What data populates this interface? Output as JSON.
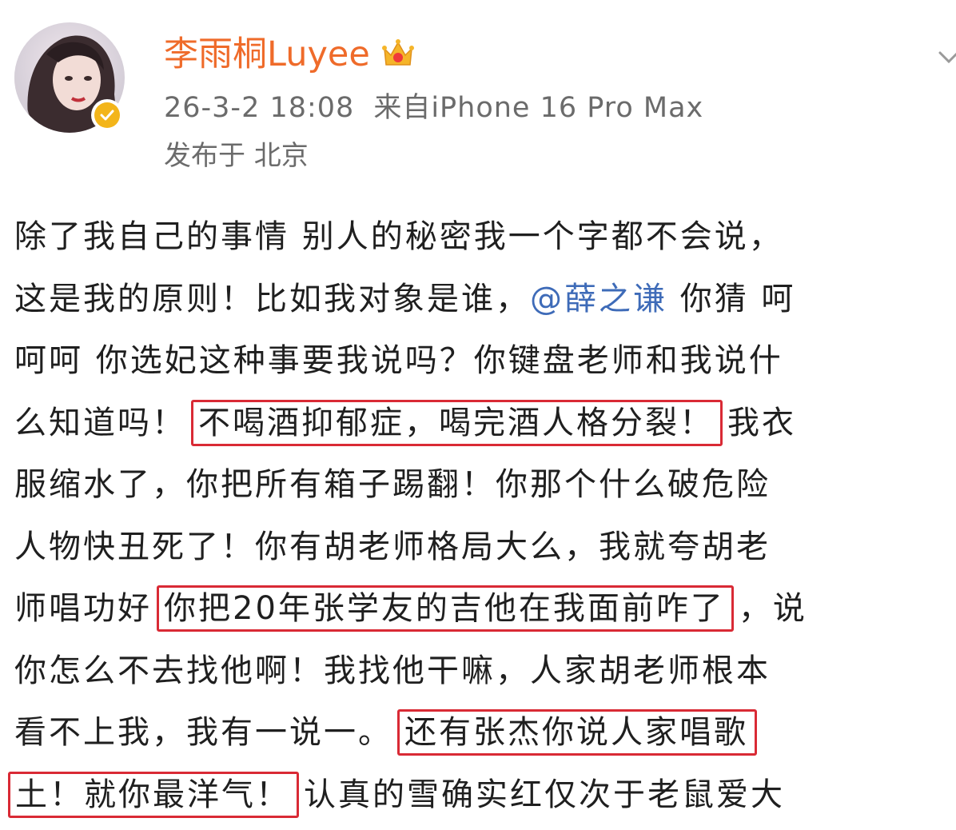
{
  "profile": {
    "username": "李雨桐Luyee",
    "timestamp": "26-3-2 18:08",
    "source": "来自iPhone 16 Pro Max",
    "location": "发布于 北京",
    "avatar_icon": "profile-photo",
    "verified_icon": "verified-badge-icon",
    "crown_icon": "vip-crown-icon",
    "menu_icon": "chevron-down-icon"
  },
  "colors": {
    "username": "#ef6b2a",
    "mention": "#3e6bb8",
    "highlight_box": "#d92a35",
    "meta_text": "#6b6b6b",
    "verified_badge": "#f3b51a"
  },
  "post": {
    "l1": "除了我自己的事情 别人的秘密我一个字都不会说，",
    "l2_a": "这是我的原则！比如我对象是谁，",
    "l2_mention": "@薛之谦",
    "l2_b": " 你猜 呵",
    "l3": "呵呵 你选妃这种事要我说吗？你键盘老师和我说什",
    "l4_a": "么知道吗！",
    "l4_hl": "不喝酒抑郁症，喝完酒人格分裂！",
    "l4_b": "我衣",
    "l5": "服缩水了，你把所有箱子踢翻！你那个什么破危险",
    "l6": "人物快丑死了！你有胡老师格局大么，我就夸胡老",
    "l7_a": "师唱功好",
    "l7_hl": "你把20年张学友的吉他在我面前咋了",
    "l7_b": "，说",
    "l8": "你怎么不去找他啊！我找他干嘛，人家胡老师根本",
    "l9_a": "看不上我，我有一说一。",
    "l9_hl": "还有张杰你说人家唱歌",
    "l10_hl": "土！就你最洋气！",
    "l10_b": "认真的雪确实红仅次于老鼠爱大"
  }
}
